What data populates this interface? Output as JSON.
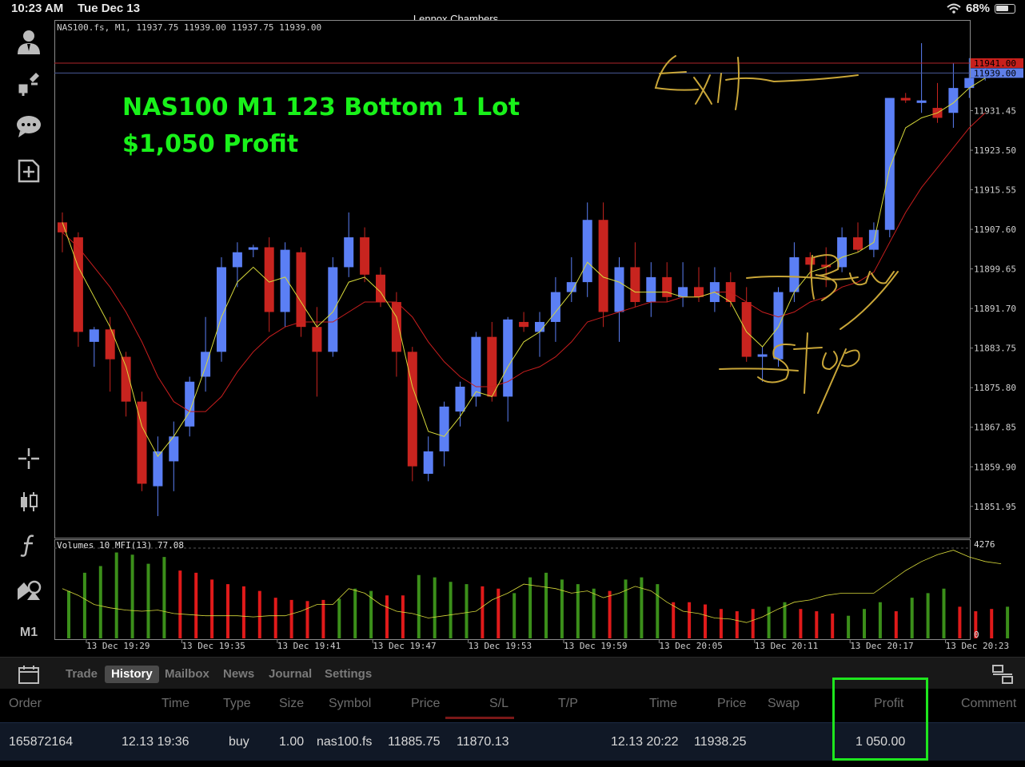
{
  "status_bar": {
    "time": "10:23 AM",
    "day": "Tue Dec 13",
    "watermark": "Lennox Chambers",
    "battery": "68%",
    "battery_level": 0.68
  },
  "left_toolbar": {
    "items": [
      {
        "icon": "account-icon"
      },
      {
        "icon": "quotes-icon"
      },
      {
        "icon": "chat-icon"
      },
      {
        "icon": "new-order-icon"
      },
      {
        "icon": "crosshair-icon"
      },
      {
        "icon": "chart-type-icon"
      },
      {
        "icon": "indicator-icon"
      },
      {
        "icon": "objects-icon"
      }
    ],
    "timeframe": "M1"
  },
  "chart": {
    "header": "NAS100.fs, M1, 11937.75 11939.00 11937.75 11939.00",
    "volume_label": "Volumes 10 MFI(13) 77.08",
    "ask_tag": "11941.00",
    "bid_tag": "11939.00",
    "volume_max_label": "4276",
    "volume_min_label": "0",
    "overlay_line1": "NAS100 M1 123 Bottom 1 Lot",
    "overlay_line2": "$1,050 Profit",
    "handwritten_notes": [
      "Exit",
      "Buy",
      "Stop"
    ],
    "colors": {
      "up": "#5b7ff5",
      "down": "#c8241f",
      "ma_fast": "#d7d93a",
      "ma_slow": "#c81e1e",
      "overlay_text": "#19f21a",
      "vol_up": "#3b8f1a",
      "vol_down": "#e01a1a"
    }
  },
  "chart_data": {
    "type": "candlestick",
    "symbol": "NAS100.fs",
    "timeframe": "M1",
    "y_ticks": [
      "11931.45",
      "11923.50",
      "11915.55",
      "11907.60",
      "11899.65",
      "11891.70",
      "11883.75",
      "11875.80",
      "11867.85",
      "11859.90",
      "11851.95"
    ],
    "ylim": [
      11845.5,
      11949.5
    ],
    "x_ticks": [
      "13 Dec 19:29",
      "13 Dec 19:35",
      "13 Dec 19:41",
      "13 Dec 19:47",
      "13 Dec 19:53",
      "13 Dec 19:59",
      "13 Dec 20:05",
      "13 Dec 20:11",
      "13 Dec 20:17",
      "13 Dec 20:23"
    ],
    "candles": [
      {
        "o": 11909.0,
        "h": 11911.0,
        "l": 11903.0,
        "c": 11907.0
      },
      {
        "o": 11906.0,
        "h": 11907.0,
        "l": 11884.0,
        "c": 11887.0
      },
      {
        "o": 11885.0,
        "h": 11888.0,
        "l": 11880.0,
        "c": 11887.5
      },
      {
        "o": 11887.5,
        "h": 11890.0,
        "l": 11875.0,
        "c": 11881.5
      },
      {
        "o": 11882.0,
        "h": 11883.0,
        "l": 11870.0,
        "c": 11873.0
      },
      {
        "o": 11873.0,
        "h": 11875.0,
        "l": 11855.0,
        "c": 11856.5
      },
      {
        "o": 11856.0,
        "h": 11866.0,
        "l": 11850.0,
        "c": 11863.0
      },
      {
        "o": 11861.0,
        "h": 11869.0,
        "l": 11855.0,
        "c": 11866.0
      },
      {
        "o": 11868.0,
        "h": 11878.0,
        "l": 11866.0,
        "c": 11877.0
      },
      {
        "o": 11878.0,
        "h": 11890.0,
        "l": 11875.0,
        "c": 11883.0
      },
      {
        "o": 11883.0,
        "h": 11902.0,
        "l": 11881.0,
        "c": 11900.0
      },
      {
        "o": 11900.0,
        "h": 11905.0,
        "l": 11896.0,
        "c": 11903.0
      },
      {
        "o": 11903.5,
        "h": 11904.5,
        "l": 11902.0,
        "c": 11904.0
      },
      {
        "o": 11904.0,
        "h": 11906.0,
        "l": 11887.0,
        "c": 11891.0
      },
      {
        "o": 11891.0,
        "h": 11905.0,
        "l": 11888.0,
        "c": 11903.5
      },
      {
        "o": 11903.0,
        "h": 11904.0,
        "l": 11886.0,
        "c": 11888.0
      },
      {
        "o": 11888.0,
        "h": 11892.0,
        "l": 11874.0,
        "c": 11883.0
      },
      {
        "o": 11883.0,
        "h": 11902.0,
        "l": 11882.0,
        "c": 11900.0
      },
      {
        "o": 11900.0,
        "h": 11911.0,
        "l": 11898.0,
        "c": 11906.0
      },
      {
        "o": 11906.0,
        "h": 11908.0,
        "l": 11897.0,
        "c": 11898.5
      },
      {
        "o": 11898.5,
        "h": 11900.0,
        "l": 11892.0,
        "c": 11893.0
      },
      {
        "o": 11893.0,
        "h": 11895.0,
        "l": 11878.0,
        "c": 11883.0
      },
      {
        "o": 11883.0,
        "h": 11884.0,
        "l": 11857.0,
        "c": 11860.0
      },
      {
        "o": 11858.5,
        "h": 11866.0,
        "l": 11857.0,
        "c": 11863.0
      },
      {
        "o": 11863.0,
        "h": 11873.0,
        "l": 11860.0,
        "c": 11872.0
      },
      {
        "o": 11871.0,
        "h": 11877.0,
        "l": 11868.0,
        "c": 11876.0
      },
      {
        "o": 11874.0,
        "h": 11887.0,
        "l": 11872.0,
        "c": 11886.0
      },
      {
        "o": 11886.0,
        "h": 11889.0,
        "l": 11873.0,
        "c": 11874.0
      },
      {
        "o": 11874.0,
        "h": 11890.0,
        "l": 11869.0,
        "c": 11889.5
      },
      {
        "o": 11889.0,
        "h": 11891.0,
        "l": 11887.0,
        "c": 11888.0
      },
      {
        "o": 11887.0,
        "h": 11891.0,
        "l": 11882.0,
        "c": 11889.0
      },
      {
        "o": 11889.0,
        "h": 11898.0,
        "l": 11885.0,
        "c": 11895.0
      },
      {
        "o": 11895.0,
        "h": 11902.0,
        "l": 11893.0,
        "c": 11897.0
      },
      {
        "o": 11897.0,
        "h": 11913.0,
        "l": 11894.0,
        "c": 11909.5
      },
      {
        "o": 11909.5,
        "h": 11913.0,
        "l": 11888.0,
        "c": 11891.0
      },
      {
        "o": 11891.0,
        "h": 11902.0,
        "l": 11885.0,
        "c": 11900.0
      },
      {
        "o": 11900.0,
        "h": 11905.0,
        "l": 11892.0,
        "c": 11893.0
      },
      {
        "o": 11893.0,
        "h": 11901.0,
        "l": 11890.0,
        "c": 11898.0
      },
      {
        "o": 11898.0,
        "h": 11901.0,
        "l": 11893.0,
        "c": 11894.0
      },
      {
        "o": 11894.0,
        "h": 11901.0,
        "l": 11892.0,
        "c": 11896.0
      },
      {
        "o": 11896.0,
        "h": 11900.0,
        "l": 11893.0,
        "c": 11894.0
      },
      {
        "o": 11893.0,
        "h": 11900.0,
        "l": 11891.0,
        "c": 11897.0
      },
      {
        "o": 11897.0,
        "h": 11899.0,
        "l": 11892.0,
        "c": 11893.0
      },
      {
        "o": 11893.0,
        "h": 11896.0,
        "l": 11881.0,
        "c": 11882.0
      },
      {
        "o": 11882.0,
        "h": 11884.0,
        "l": 11877.0,
        "c": 11882.5
      },
      {
        "o": 11881.5,
        "h": 11896.0,
        "l": 11880.0,
        "c": 11895.0
      },
      {
        "o": 11895.0,
        "h": 11905.0,
        "l": 11893.0,
        "c": 11902.0
      },
      {
        "o": 11902.0,
        "h": 11903.0,
        "l": 11898.0,
        "c": 11900.5
      },
      {
        "o": 11900.5,
        "h": 11904.0,
        "l": 11896.0,
        "c": 11900.0
      },
      {
        "o": 11900.0,
        "h": 11908.0,
        "l": 11899.0,
        "c": 11906.0
      },
      {
        "o": 11906.0,
        "h": 11909.0,
        "l": 11903.0,
        "c": 11903.5
      },
      {
        "o": 11903.5,
        "h": 11909.0,
        "l": 11902.0,
        "c": 11907.5
      },
      {
        "o": 11907.5,
        "h": 11933.0,
        "l": 11906.0,
        "c": 11934.0
      },
      {
        "o": 11934.0,
        "h": 11935.0,
        "l": 11933.0,
        "c": 11933.5
      },
      {
        "o": 11933.0,
        "h": 11945.0,
        "l": 11931.0,
        "c": 11933.5
      },
      {
        "o": 11932.0,
        "h": 11937.0,
        "l": 11929.0,
        "c": 11930.0
      },
      {
        "o": 11931.0,
        "h": 11941.0,
        "l": 11928.0,
        "c": 11936.0
      },
      {
        "o": 11936.0,
        "h": 11942.0,
        "l": 11934.0,
        "c": 11938.0
      },
      {
        "o": 11938.0,
        "h": 11940.0,
        "l": 11937.5,
        "c": 11939.0
      }
    ],
    "ma_fast": [
      11909,
      11900,
      11894,
      11888,
      11880,
      11868,
      11862,
      11866,
      11871,
      11880,
      11890,
      11897,
      11900,
      11897,
      11898,
      11893,
      11888,
      11891,
      11897,
      11898,
      11895,
      11890,
      11876,
      11867,
      11866,
      11870,
      11875,
      11874,
      11880,
      11885,
      11887,
      11891,
      11895,
      11901,
      11898,
      11897,
      11895,
      11895,
      11895,
      11894,
      11894,
      11895,
      11893,
      11887,
      11884,
      11888,
      11895,
      11899,
      11900,
      11902,
      11903,
      11905,
      11920,
      11928,
      11930,
      11931,
      11933,
      11936,
      11938
    ],
    "ma_slow": [
      11907,
      11904,
      11900,
      11896,
      11891,
      11885,
      11878,
      11873,
      11871,
      11871,
      11874,
      11879,
      11883,
      11886,
      11888,
      11889,
      11889,
      11889,
      11891,
      11893,
      11893,
      11893,
      11890,
      11885,
      11881,
      11878,
      11876,
      11876,
      11877,
      11879,
      11880,
      11882,
      11885,
      11889,
      11890,
      11891,
      11892,
      11893,
      11893,
      11894,
      11894,
      11895,
      11895,
      11893,
      11891,
      11890,
      11891,
      11893,
      11894,
      11896,
      11897,
      11899,
      11905,
      11911,
      11916,
      11920,
      11924,
      11928,
      11931
    ],
    "volume": {
      "ylim": [
        0,
        4276
      ],
      "values": [
        2100,
        2900,
        3200,
        3800,
        3700,
        3300,
        3600,
        3000,
        2900,
        2600,
        2400,
        2300,
        2100,
        1800,
        1700,
        1650,
        1700,
        1750,
        2200,
        2100,
        1900,
        1900,
        2800,
        2700,
        2500,
        2400,
        2300,
        2200,
        2000,
        2700,
        2900,
        2600,
        2400,
        2200,
        2100,
        2600,
        2700,
        2400,
        1600,
        1600,
        1500,
        1300,
        1200,
        1300,
        1400,
        1600,
        1300,
        1200,
        1100,
        1000,
        1300,
        1600,
        1200,
        1800,
        2000,
        2200,
        1400,
        1200,
        1300,
        1400
      ],
      "up": [
        1,
        1,
        1,
        1,
        1,
        1,
        1,
        0,
        0,
        0,
        0,
        0,
        0,
        0,
        0,
        0,
        0,
        1,
        1,
        1,
        0,
        0,
        1,
        1,
        1,
        1,
        0,
        0,
        1,
        1,
        1,
        1,
        1,
        1,
        0,
        1,
        1,
        1,
        0,
        0,
        0,
        0,
        0,
        0,
        1,
        1,
        0,
        0,
        0,
        1,
        1,
        1,
        0,
        1,
        1,
        1,
        0,
        0,
        0,
        1
      ],
      "mfi": [
        2200,
        1900,
        1500,
        1350,
        1250,
        1200,
        1250,
        1100,
        1050,
        1000,
        1000,
        1000,
        950,
        1000,
        1000,
        1200,
        1500,
        1500,
        2200,
        2000,
        1500,
        1200,
        1100,
        900,
        1000,
        1100,
        1200,
        1700,
        2000,
        2400,
        2300,
        2200,
        2000,
        2100,
        1800,
        2000,
        2300,
        2100,
        1600,
        1200,
        1100,
        900,
        850,
        700,
        950,
        1300,
        1600,
        1700,
        1900,
        2000,
        2000,
        2000,
        2500,
        3000,
        3400,
        3700,
        3900,
        3600,
        3400,
        3300
      ]
    }
  },
  "tabbar": {
    "tabs": [
      {
        "label": "Trade",
        "active": false
      },
      {
        "label": "History",
        "active": true
      },
      {
        "label": "Mailbox",
        "active": false
      },
      {
        "label": "News",
        "active": false
      },
      {
        "label": "Journal",
        "active": false
      },
      {
        "label": "Settings",
        "active": false
      }
    ]
  },
  "history_table": {
    "columns": [
      "Order",
      "Time",
      "Type",
      "Size",
      "Symbol",
      "Price",
      "S/L",
      "T/P",
      "Time",
      "Price",
      "Swap",
      "Profit",
      "Comment"
    ],
    "rows": [
      [
        "165872164",
        "12.13 19:36",
        "buy",
        "1.00",
        "nas100.fs",
        "11885.75",
        "11870.13",
        "",
        "12.13 20:22",
        "11938.25",
        "",
        "1 050.00",
        ""
      ]
    ]
  }
}
